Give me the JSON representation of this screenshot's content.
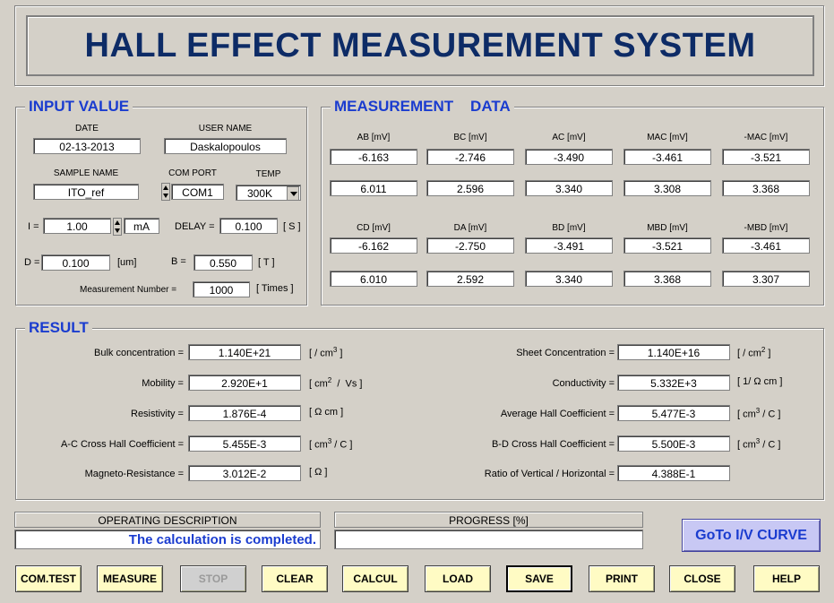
{
  "title": "HALL EFFECT MEASUREMENT SYSTEM",
  "input": {
    "heading": "INPUT VALUE",
    "date_label": "DATE",
    "date_value": "02-13-2013",
    "user_label": "USER NAME",
    "user_value": "Daskalopoulos",
    "sample_label": "SAMPLE NAME",
    "sample_value": "ITO_ref",
    "com_label": "COM PORT",
    "com_value": "COM1",
    "temp_label": "TEMP",
    "temp_value": "300K",
    "i_label": "I =",
    "i_value": "1.00",
    "i_unit": "mA",
    "delay_label": "DELAY =",
    "delay_value": "0.100",
    "delay_unit": "[ S ]",
    "d_label": "D =",
    "d_value": "0.100",
    "d_unit": "[um]",
    "b_label": "B =",
    "b_value": "0.550",
    "b_unit": "[ T ]",
    "mnum_label": "Measurement Number  =",
    "mnum_value": "1000",
    "mnum_unit": "[ Times ]"
  },
  "measurement": {
    "heading": "MEASUREMENT    DATA",
    "headers1": [
      "AB [mV]",
      "BC [mV]",
      "AC [mV]",
      "MAC [mV]",
      "-MAC [mV]"
    ],
    "row1a": [
      "-6.163",
      "-2.746",
      "-3.490",
      "-3.461",
      "-3.521"
    ],
    "row1b": [
      "6.011",
      "2.596",
      "3.340",
      "3.308",
      "3.368"
    ],
    "headers2": [
      "CD [mV]",
      "DA [mV]",
      "BD [mV]",
      "MBD [mV]",
      "-MBD [mV]"
    ],
    "row2a": [
      "-6.162",
      "-2.750",
      "-3.491",
      "-3.521",
      "-3.461"
    ],
    "row2b": [
      "6.010",
      "2.592",
      "3.340",
      "3.368",
      "3.307"
    ]
  },
  "result": {
    "heading": "RESULT",
    "left": [
      {
        "label": "Bulk concentration =",
        "value": "1.140E+21",
        "unit": "[ / cm",
        "sup": "3",
        "unit2": " ]"
      },
      {
        "label": "Mobility =",
        "value": "2.920E+1",
        "unit": "[ cm",
        "sup": "2",
        "unit2": "  /  Vs ]"
      },
      {
        "label": "Resistivity =",
        "value": "1.876E-4",
        "unit": "[ Ω cm ]",
        "sup": "",
        "unit2": ""
      },
      {
        "label": "A-C Cross Hall Coefficient =",
        "value": "5.455E-3",
        "unit": "[ cm",
        "sup": "3",
        "unit2": " / C ]"
      },
      {
        "label": "Magneto-Resistance =",
        "value": "3.012E-2",
        "unit": "[ Ω ]",
        "sup": "",
        "unit2": ""
      }
    ],
    "right": [
      {
        "label": "Sheet Concentration =",
        "value": "1.140E+16",
        "unit": "[ / cm",
        "sup": "2",
        "unit2": " ]"
      },
      {
        "label": "Conductivity =",
        "value": "5.332E+3",
        "unit": "[ 1/ Ω cm ]",
        "sup": "",
        "unit2": ""
      },
      {
        "label": "Average Hall Coefficient =",
        "value": "5.477E-3",
        "unit": "[ cm",
        "sup": "3",
        "unit2": " / C ]"
      },
      {
        "label": "B-D Cross Hall Coefficient =",
        "value": "5.500E-3",
        "unit": "[ cm",
        "sup": "3",
        "unit2": " / C ]"
      },
      {
        "label": "Ratio of Vertical / Horizontal =",
        "value": "4.388E-1",
        "unit": "",
        "sup": "",
        "unit2": ""
      }
    ]
  },
  "status": {
    "op_label": "OPERATING    DESCRIPTION",
    "op_text": "The calculation  is completed.",
    "progress_label": "PROGRESS [%]",
    "progress_value": 0
  },
  "goto_label": "GoTo I/V CURVE",
  "buttons": [
    "COM.TEST",
    "MEASURE",
    "STOP",
    "CLEAR",
    "CALCUL",
    "LOAD",
    "SAVE",
    "PRINT",
    "CLOSE",
    "HELP"
  ]
}
